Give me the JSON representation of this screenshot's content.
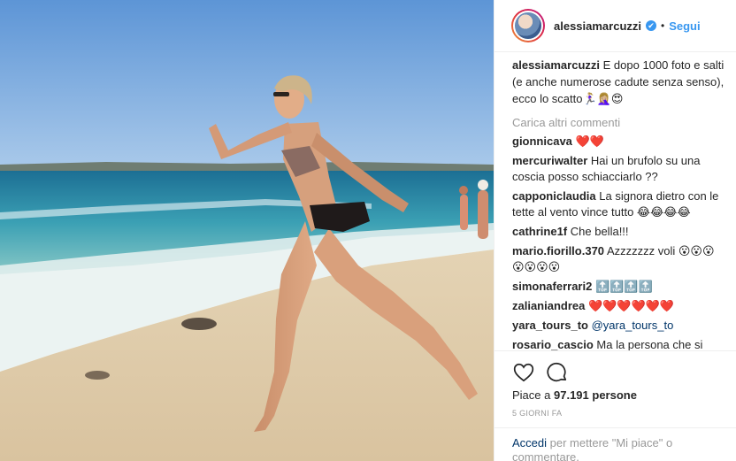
{
  "header": {
    "username": "alessiamarcuzzi",
    "verified_mark": "✔",
    "separator": "•",
    "follow_label": "Segui"
  },
  "caption": {
    "username": "alessiamarcuzzi",
    "text": "E dopo 1000 foto e salti (e anche numerose cadute senza senso), ecco lo scatto🏃🏼‍♀️🤦🏼‍♀️😍"
  },
  "load_more_label": "Carica altri commenti",
  "comments": [
    {
      "user": "gionnicava",
      "text": "❤️❤️"
    },
    {
      "user": "mercuriwalter",
      "text": "Hai un brufolo su una coscia posso schiacciarlo ??"
    },
    {
      "user": "capponiclaudia",
      "text": "La signora dietro con le tette al vento vince tutto 😂😂😂😂"
    },
    {
      "user": "cathrine1f",
      "text": "Che bella!!!"
    },
    {
      "user": "mario.fiorillo.370",
      "text": "Azzzzzzz voli 😮😮😮😮😮😮😮"
    },
    {
      "user": "simonaferrari2",
      "text": "🔝🔝🔝🔝"
    },
    {
      "user": "zalianiandrea",
      "text": "❤️❤️❤️❤️❤️❤️"
    },
    {
      "user": "yara_tours_to",
      "text": "@yara_tours_to"
    },
    {
      "user": "rosario_cascio",
      "text": "Ma la persona che si vede"
    }
  ],
  "icons": {
    "like": "heart-icon",
    "comment": "comment-icon"
  },
  "likes": {
    "prefix": "Piace a",
    "count": "97.191",
    "suffix": "persone"
  },
  "timestamp": "5 GIORNI FA",
  "login_prompt": {
    "link": "Accedi",
    "text": "per mettere \"Mi piace\" o commentare."
  },
  "colors": {
    "link_blue": "#3897f0",
    "text": "#262626",
    "muted": "#999999",
    "border": "#efefef"
  }
}
